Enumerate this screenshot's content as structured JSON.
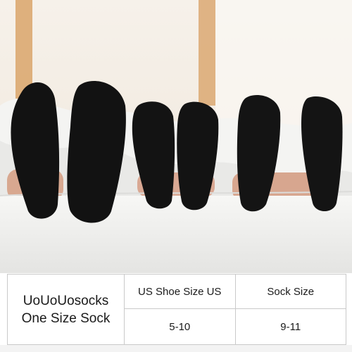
{
  "photo": {
    "icon": "socks-on-feet-photo",
    "colors": {
      "window": "#f4ede3",
      "frame": "#d9a46a",
      "bedding": "#f2f2f0",
      "sock": "#121212"
    }
  },
  "size_table": {
    "brand_line1": "UoUoUosocks",
    "brand_line2": "One Size Sock",
    "shoe_header": "US Shoe Size US",
    "sock_header": "Sock Size",
    "shoe_value": "5-10",
    "sock_value": "9-11"
  }
}
